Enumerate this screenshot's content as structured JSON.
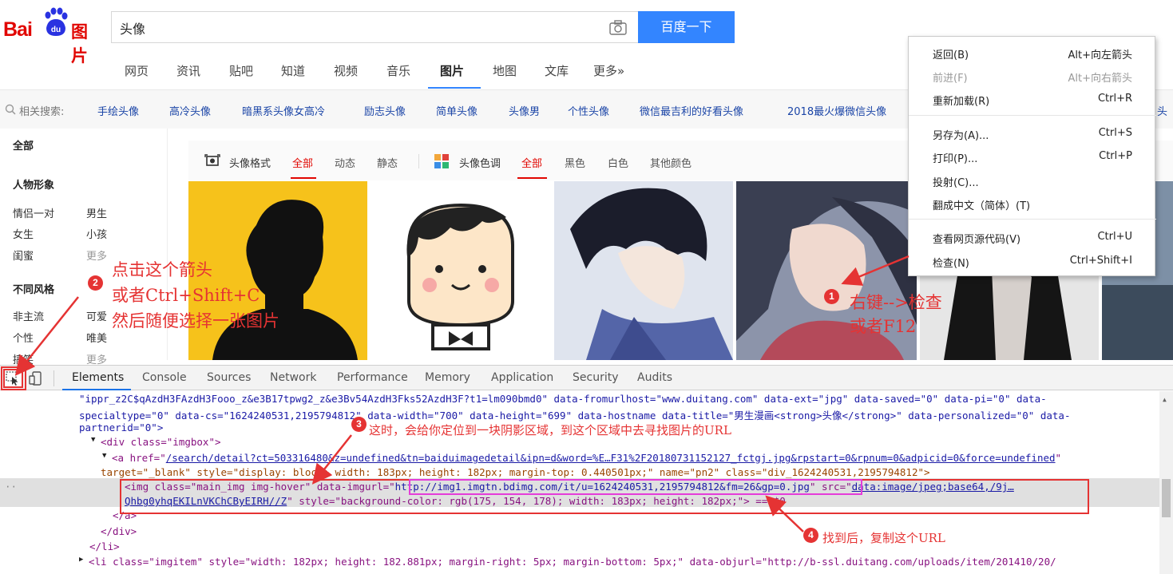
{
  "header": {
    "logo_bai": "Bai",
    "logo_du": "du",
    "logo_tupian": "图片",
    "search_value": "头像",
    "search_button": "百度一下"
  },
  "nav": {
    "items": [
      "网页",
      "资讯",
      "贴吧",
      "知道",
      "视频",
      "音乐",
      "图片",
      "地图",
      "文库",
      "更多»"
    ],
    "active": "图片"
  },
  "related": {
    "label": "相关搜索:",
    "links": [
      "手绘头像",
      "高冷头像",
      "暗黑系头像女高冷",
      "励志头像",
      "简单头像",
      "头像男",
      "个性头像",
      "微信最吉利的好看头像",
      "2018最火爆微信头像",
      "头"
    ]
  },
  "sidebar": {
    "all": "全部",
    "group1_title": "人物形象",
    "group1": [
      [
        "情侣一对",
        "男生"
      ],
      [
        "女生",
        "小孩"
      ],
      [
        "闺蜜",
        "更多"
      ]
    ],
    "group2_title": "不同风格",
    "group2": [
      [
        "非主流",
        "可爱"
      ],
      [
        "个性",
        "唯美"
      ],
      [
        "搞笑",
        "更多"
      ]
    ]
  },
  "filter": {
    "format_label": "头像格式",
    "format_options": [
      "全部",
      "动态",
      "静态"
    ],
    "color_label": "头像色调",
    "color_options": [
      "全部",
      "黑色",
      "白色",
      "其他颜色"
    ]
  },
  "context_menu": {
    "items": [
      {
        "label": "返回(B)",
        "shortcut": "Alt+向左箭头",
        "disabled": false
      },
      {
        "label": "前进(F)",
        "shortcut": "Alt+向右箭头",
        "disabled": true
      },
      {
        "label": "重新加载(R)",
        "shortcut": "Ctrl+R",
        "disabled": false
      },
      {
        "label": "另存为(A)...",
        "shortcut": "Ctrl+S",
        "disabled": false
      },
      {
        "label": "打印(P)...",
        "shortcut": "Ctrl+P",
        "disabled": false
      },
      {
        "label": "投射(C)...",
        "shortcut": "",
        "disabled": false
      },
      {
        "label": "翻成中文（简体）(T)",
        "shortcut": "",
        "disabled": false
      },
      {
        "label": "查看网页源代码(V)",
        "shortcut": "Ctrl+U",
        "disabled": false
      },
      {
        "label": "检查(N)",
        "shortcut": "Ctrl+Shift+I",
        "disabled": false
      }
    ]
  },
  "devtools": {
    "tabs": [
      "Elements",
      "Console",
      "Sources",
      "Network",
      "Performance",
      "Memory",
      "Application",
      "Security",
      "Audits"
    ],
    "active_tab": "Elements",
    "code": {
      "l1": "\"ippr_z2C$qAzdH3FAzdH3Fooo_z&e3B17tpwg2_z&e3Bv54AzdH3Fks52AzdH3F?t1=lm090bmd0\" data-fromurlhost=\"www.duitang.com\" data-ext=\"jpg\" data-saved=\"0\" data-pi=\"0\" data-",
      "l2": "specialtype=\"0\" data-cs=\"1624240531,2195794812\" data-width=\"700\" data-height=\"699\" data-hostname data-title=\"男生漫画<strong>头像</strong>\" data-personalized=\"0\" data-",
      "l3": "partnerid=\"0\">",
      "l4_tag": "<div class=\"imgbox\">",
      "l5a": "<a href=\"",
      "l5_href": "/search/detail?ct=503316480&z=undefined&tn=baiduimagedetail&ipn=d&word=%E…F31%2F20180731152127_fctgj.jpg&rpstart=0&rpnum=0&adpicid=0&force=undefined",
      "l6": "target=\"_blank\" style=\"display: block; width: 183px; height: 182px; margin-top: 0.440501px;\" name=\"pn2\" class=\"div_1624240531,2195794812\">",
      "l7a": "<img class=\"main_img img-hover\" data-imgurl=\"",
      "l7_url": "http://img1.imgtn.bdimg.com/it/u=1624240531,2195794812&fm=26&gp=0.jpg",
      "l7b": "\" src=\"",
      "l7_src": "data:image/jpeg;base64,/9j…",
      "l8_src": "Qhbg0yhqEKILnVKChCByEIRH//Z",
      "l8b": "\" style=\"background-color: rgb(175, 154, 178); width: 183px; height: 182px;\"> == $0",
      "l9": "</a>",
      "l10": "</div>",
      "l11": "</li>",
      "l12": "<li class=\"imgitem\" style=\"width: 182px; height: 182.881px; margin-right: 5px; margin-bottom: 5px;\" data-objurl=\"http://b-ssl.duitang.com/uploads/item/201410/20/"
    }
  },
  "annotations": {
    "n1": "1",
    "t1_line1": "右键-->检查",
    "t1_line2": "或者F12",
    "n2": "2",
    "t2_line1": "点击这个箭头",
    "t2_line2": "或者Ctrl+Shift+C",
    "t2_line3": "然后随便选择一张图片",
    "n3": "3",
    "t3": "这时，会给你定位到一块阴影区域，到这个区域中去寻找图片的URL",
    "n4": "4",
    "t4": "找到后，复制这个URL",
    "color": "#e53333"
  }
}
